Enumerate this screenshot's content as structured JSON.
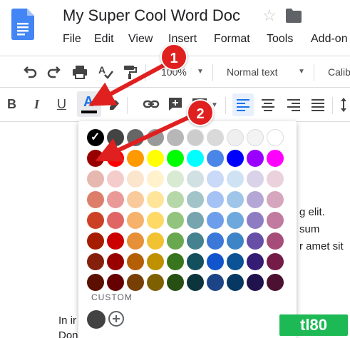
{
  "doc": {
    "title": "My Super Cool Word Doc"
  },
  "menu": [
    "File",
    "Edit",
    "View",
    "Insert",
    "Format",
    "Tools",
    "Add-on"
  ],
  "toolbar": {
    "zoom": "100%",
    "style": "Normal text",
    "font": "Calib"
  },
  "format": {
    "bold": "B",
    "italic": "I",
    "underline": "U",
    "text_color": "A"
  },
  "body_text": [
    "g elit.",
    "sum",
    "r amet sit",
    "In ir",
    "Don"
  ],
  "palette": {
    "custom_label": "CUSTOM",
    "rows": [
      [
        "#000000",
        "#434343",
        "#666666",
        "#999999",
        "#b7b7b7",
        "#cccccc",
        "#d9d9d9",
        "#efefef",
        "#f3f3f3",
        "#ffffff"
      ],
      [
        "#980000",
        "#ff0000",
        "#ff9900",
        "#ffff00",
        "#00ff00",
        "#00ffff",
        "#4a86e8",
        "#0000ff",
        "#9900ff",
        "#ff00ff"
      ],
      [
        "#e6b8af",
        "#f4cccc",
        "#fce5cd",
        "#fff2cc",
        "#d9ead3",
        "#d0e0e3",
        "#c9daf8",
        "#cfe2f3",
        "#d9d2e9",
        "#ead1dc"
      ],
      [
        "#dd7e6b",
        "#ea9999",
        "#f9cb9c",
        "#ffe599",
        "#b6d7a8",
        "#a2c4c9",
        "#a4c2f4",
        "#9fc5e8",
        "#b4a7d6",
        "#d5a6bd"
      ],
      [
        "#cc4125",
        "#e06666",
        "#f6b26b",
        "#ffd966",
        "#93c47d",
        "#76a5af",
        "#6d9eeb",
        "#6fa8dc",
        "#8e7cc3",
        "#c27ba0"
      ],
      [
        "#a61c00",
        "#cc0000",
        "#e69138",
        "#f1c232",
        "#6aa84f",
        "#45818e",
        "#3c78d8",
        "#3d85c6",
        "#674ea7",
        "#a64d79"
      ],
      [
        "#85200c",
        "#990000",
        "#b45f06",
        "#bf9000",
        "#38761d",
        "#134f5c",
        "#1155cc",
        "#0b5394",
        "#351c75",
        "#741b47"
      ],
      [
        "#5b0f00",
        "#660000",
        "#783f04",
        "#7f6000",
        "#274e13",
        "#0c343d",
        "#1c4587",
        "#073763",
        "#20124d",
        "#4c1130"
      ]
    ],
    "selected": "#000000",
    "custom_color": "#424242"
  },
  "callouts": [
    "1",
    "2"
  ],
  "watermark": "tl80",
  "colors": {
    "accent": "#1a73e8",
    "callout": "#e0201f"
  },
  "icons": [
    "docs-logo-icon",
    "star-icon",
    "folder-icon",
    "undo-icon",
    "redo-icon",
    "print-icon",
    "spellcheck-icon",
    "paint-format-icon",
    "link-icon",
    "insert-comment-icon",
    "highlight-icon",
    "align-left-icon",
    "align-center-icon",
    "align-right-icon",
    "align-justify-icon",
    "line-spacing-icon",
    "add-icon"
  ]
}
